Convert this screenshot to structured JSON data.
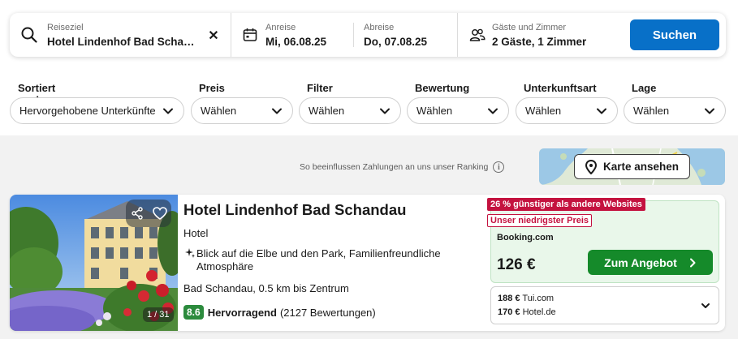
{
  "search": {
    "destination_label": "Reiseziel",
    "destination_value": "Hotel Lindenhof Bad Schandau",
    "checkin_label": "Anreise",
    "checkin_value": "Mi, 06.08.25",
    "checkout_label": "Abreise",
    "checkout_value": "Do, 07.08.25",
    "guests_label": "Gäste und Zimmer",
    "guests_value": "2 Gäste, 1 Zimmer",
    "search_button": "Suchen"
  },
  "filters": [
    {
      "title": "Sortiert nach",
      "value": "Hervorgehobene Unterkünfte"
    },
    {
      "title": "Preis",
      "value": "Wählen"
    },
    {
      "title": "Filter",
      "value": "Wählen"
    },
    {
      "title": "Bewertung",
      "value": "Wählen"
    },
    {
      "title": "Unterkunftsart",
      "value": "Wählen"
    },
    {
      "title": "Lage",
      "value": "Wählen"
    }
  ],
  "ranking_note": "So beeinflussen Zahlungen an uns unser Ranking",
  "map_button": "Karte ansehen",
  "hotel": {
    "name": "Hotel Lindenhof Bad Schandau",
    "type": "Hotel",
    "feature": "Blick auf die Elbe und den Park, Familienfreundliche Atmosphäre",
    "location": "Bad Schandau, 0.5 km bis Zentrum",
    "score": "8.6",
    "rating_word": "Hervorragend",
    "reviews": "(2127 Bewertungen)",
    "photo_count": "1 / 31"
  },
  "deal": {
    "badge_discount": "26 % günstiger als andere Websites",
    "badge_lowest": "Unser niedrigster Preis",
    "provider": "Booking.com",
    "price": "126 €",
    "button": "Zum Angebot"
  },
  "alternatives": [
    {
      "price": "188 €",
      "provider": "Tui.com"
    },
    {
      "price": "170 €",
      "provider": "Hotel.de"
    }
  ],
  "colors": {
    "primary": "#0870c8",
    "offer_green": "#158a2a",
    "score_green": "#2c8b3d",
    "badge_red": "#c4123f"
  }
}
